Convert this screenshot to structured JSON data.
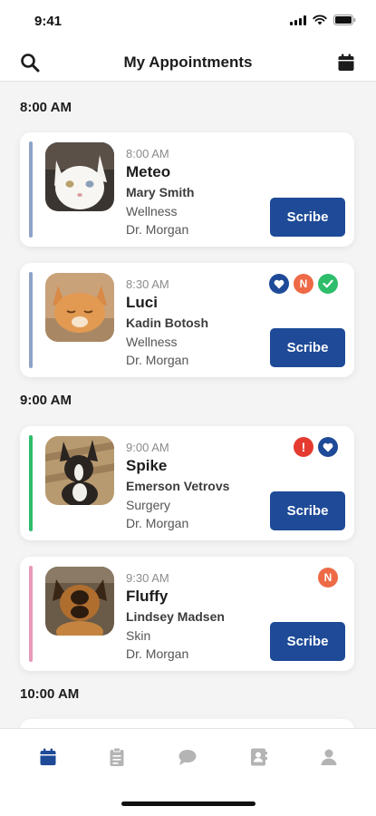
{
  "status_bar": {
    "time": "9:41"
  },
  "header": {
    "title": "My Appointments"
  },
  "time_groups": [
    "8:00 AM",
    "9:00 AM",
    "10:00 AM"
  ],
  "appointments": [
    {
      "time": "8:00 AM",
      "pet": "Meteo",
      "owner": "Mary Smith",
      "visit_type": "Wellness",
      "doctor": "Dr. Morgan",
      "action_label": "Scribe",
      "accent_color": "#8ea3c8",
      "badges": []
    },
    {
      "time": "8:30 AM",
      "pet": "Luci",
      "owner": "Kadin Botosh",
      "visit_type": "Wellness",
      "doctor": "Dr. Morgan",
      "action_label": "Scribe",
      "accent_color": "#8ea3c8",
      "badges": [
        "heart-icon",
        "N",
        "check-icon"
      ]
    },
    {
      "time": "9:00 AM",
      "pet": "Spike",
      "owner": "Emerson Vetrovs",
      "visit_type": "Surgery",
      "doctor": "Dr. Morgan",
      "action_label": "Scribe",
      "accent_color": "#2ebd6b",
      "badges": [
        "!",
        "heart-icon"
      ]
    },
    {
      "time": "9:30 AM",
      "pet": "Fluffy",
      "owner": "Lindsey Madsen",
      "visit_type": "Skin",
      "doctor": "Dr. Morgan",
      "action_label": "Scribe",
      "accent_color": "#e89ab8",
      "badges": [
        "N"
      ]
    }
  ],
  "tabs": [
    {
      "icon": "calendar-icon",
      "active": true
    },
    {
      "icon": "clipboard-icon",
      "active": false
    },
    {
      "icon": "chat-icon",
      "active": false
    },
    {
      "icon": "contacts-icon",
      "active": false
    },
    {
      "icon": "profile-icon",
      "active": false
    }
  ],
  "colors": {
    "primary": "#1e4a97",
    "badge_new": "#ee6a47",
    "badge_ok": "#2ebd6b",
    "badge_alert": "#e53a2f",
    "tab_inactive": "#b4b4b4"
  }
}
